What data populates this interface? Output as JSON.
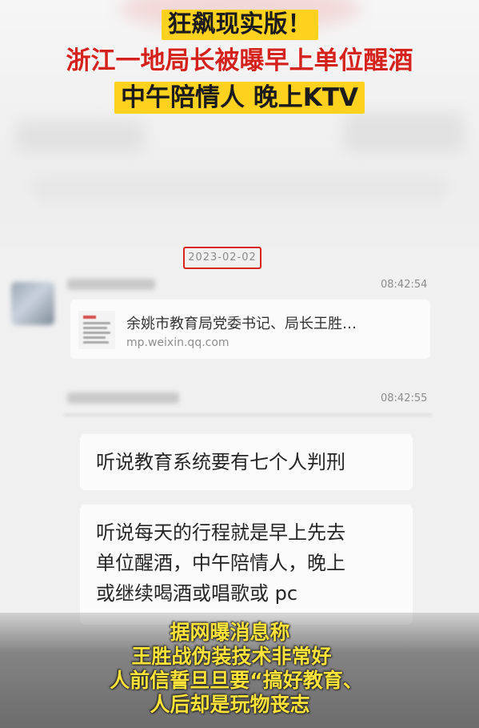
{
  "overlay": {
    "title_line1": "狂飙现实版！",
    "title_line2": "浙江一地局长被曝早上单位醒酒",
    "title_line3": "中午陪情人 晚上KTV"
  },
  "chat": {
    "date": "2023-02-02",
    "messages": [
      {
        "time": "08:42:54",
        "type": "link",
        "title": "余姚市教育局党委书记、局长王胜…",
        "url": "mp.weixin.qq.com"
      },
      {
        "time": "08:42:55",
        "type": "text",
        "text": "听说教育系统要有七个人判刑"
      },
      {
        "type": "text",
        "lines": [
          "听说每天的行程就是早上先去",
          "单位醒酒，中午陪情人，晚上",
          "或继续喝酒或唱歌或 pc"
        ]
      }
    ]
  },
  "caption": {
    "line1": "据网曝消息称",
    "line2": "王胜战伪装技术非常好",
    "line3": "人前信誓旦旦要“搞好教育、",
    "line4": "人后却是玩物丧志"
  },
  "colors": {
    "highlight_yellow": "#ffd21f",
    "title_red": "#d4221c",
    "date_box_red": "#d9261c",
    "caption_yellow": "#ffe23a"
  }
}
